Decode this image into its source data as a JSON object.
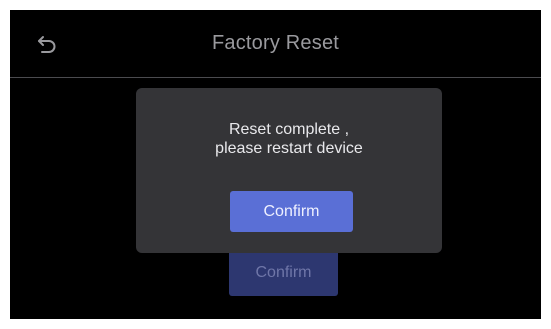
{
  "header": {
    "title": "Factory Reset",
    "back_icon": "back-arrow-icon"
  },
  "background": {
    "confirm_label": "Confirm"
  },
  "dialog": {
    "message_line1": "Reset complete ,",
    "message_line2": "please restart device",
    "confirm_label": "Confirm"
  },
  "colors": {
    "screen_background": "#000000",
    "dialog_background": "#343437",
    "primary_button": "#5a6fd6",
    "disabled_button": "#2d3770",
    "title_text": "#9a9a9e",
    "divider": "#4b4b4f"
  }
}
